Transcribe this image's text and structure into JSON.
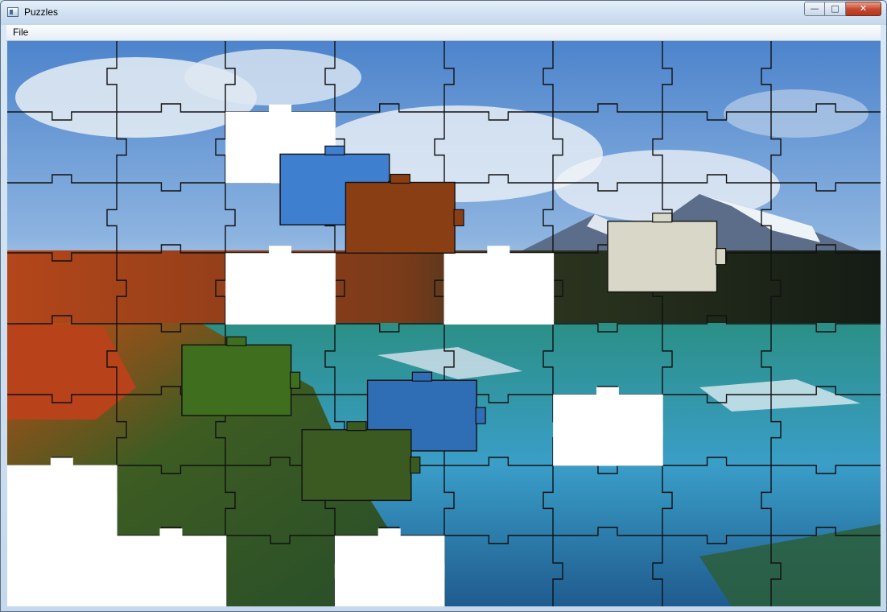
{
  "window": {
    "title": "Puzzles",
    "icon": "app-window-icon"
  },
  "caption_buttons": {
    "minimize": "—",
    "maximize": "□",
    "close": "✕"
  },
  "menu": {
    "items": [
      {
        "label": "File"
      }
    ]
  },
  "puzzle": {
    "columns": 8,
    "rows": 8,
    "empty_slots": [
      {
        "col": 2,
        "row": 1
      },
      {
        "col": 2,
        "row": 3
      },
      {
        "col": 4,
        "row": 3
      },
      {
        "col": 5,
        "row": 5
      },
      {
        "col": 0,
        "row": 6
      },
      {
        "col": 0,
        "row": 7
      },
      {
        "col": 1,
        "row": 7
      },
      {
        "col": 3,
        "row": 7
      }
    ],
    "loose_pieces": [
      {
        "col": 2.5,
        "row": 1.6,
        "color": "#3f7fd0"
      },
      {
        "col": 3.1,
        "row": 2.0,
        "color": "#8a3e14"
      },
      {
        "col": 5.5,
        "row": 2.55,
        "color": "#d9d8c8"
      },
      {
        "col": 1.6,
        "row": 4.3,
        "color": "#3f6e1f"
      },
      {
        "col": 3.3,
        "row": 4.8,
        "color": "#2f6db5"
      },
      {
        "col": 2.7,
        "row": 5.5,
        "color": "#3a5a22"
      }
    ]
  }
}
